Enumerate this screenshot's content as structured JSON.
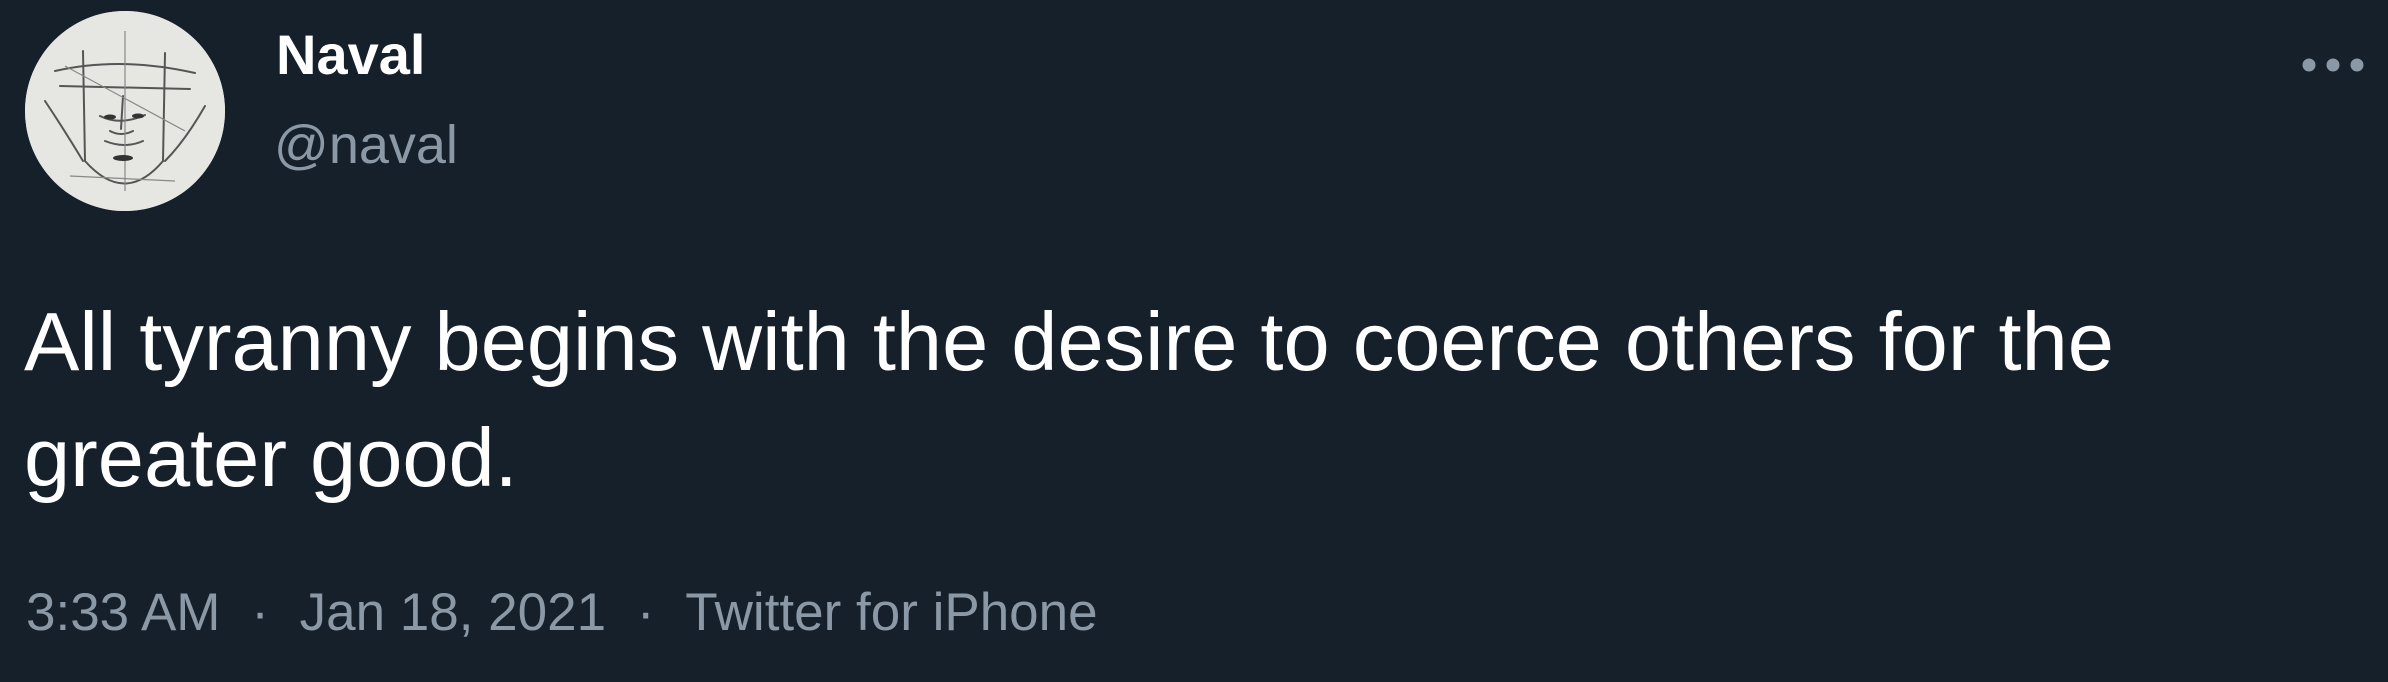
{
  "author": {
    "display_name": "Naval",
    "handle": "@naval"
  },
  "icons": {
    "avatar": "sketched-face-avatar",
    "more": "more-options-icon"
  },
  "tweet": {
    "text": "All tyranny begins with the desire to coerce others for the greater good."
  },
  "meta": {
    "time": "3:33 AM",
    "separator": "·",
    "date": "Jan 18, 2021",
    "source": "Twitter for iPhone"
  },
  "colors": {
    "background": "#16202b",
    "primary_text": "#ffffff",
    "secondary_text": "#8b98a5"
  }
}
